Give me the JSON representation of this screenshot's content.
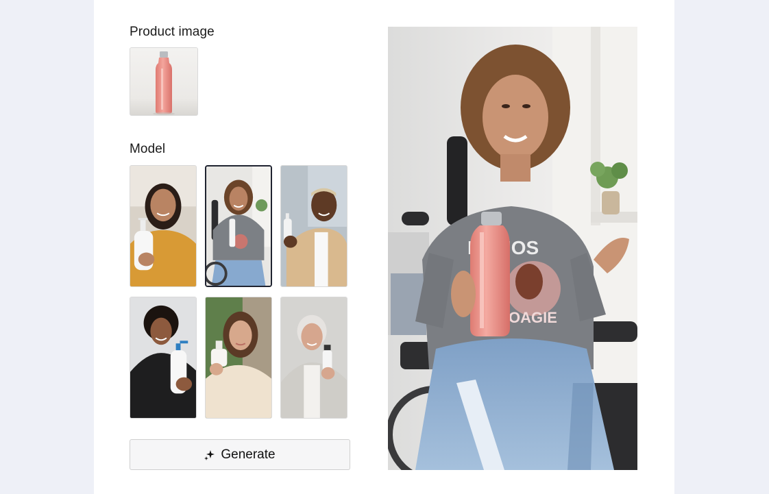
{
  "product_section": {
    "title": "Product image",
    "thumbnail": {
      "subject": "pink water bottle",
      "accent": "#ec8f86"
    }
  },
  "model_section": {
    "title": "Model",
    "models": [
      {
        "id": "model-1",
        "description": "woman in mustard sweater holding white pump bottle",
        "selected": false
      },
      {
        "id": "model-2",
        "description": "smiling woman in wheelchair with grey t-shirt",
        "selected": true
      },
      {
        "id": "model-3",
        "description": "man in beige jacket holding white bottle",
        "selected": false
      },
      {
        "id": "model-4",
        "description": "young man in black shirt holding blue pump bottle",
        "selected": false
      },
      {
        "id": "model-5",
        "description": "woman in cream top holding small white bottle",
        "selected": false
      },
      {
        "id": "model-6",
        "description": "elderly woman in grey cardigan holding small bottle",
        "selected": false
      }
    ]
  },
  "actions": {
    "generate_label": "Generate",
    "generate_icon": "sparkle-icon"
  },
  "preview": {
    "subject": "woman in wheelchair holding pink bottle",
    "accent": "#ec8f86",
    "shirt_color": "#7b7e83",
    "jeans_color": "#8fb0d4"
  },
  "colors": {
    "page_bg": "#eef0f7",
    "card_bg": "#ffffff",
    "border": "#d9d9d9",
    "selected_border": "#1f2330"
  }
}
